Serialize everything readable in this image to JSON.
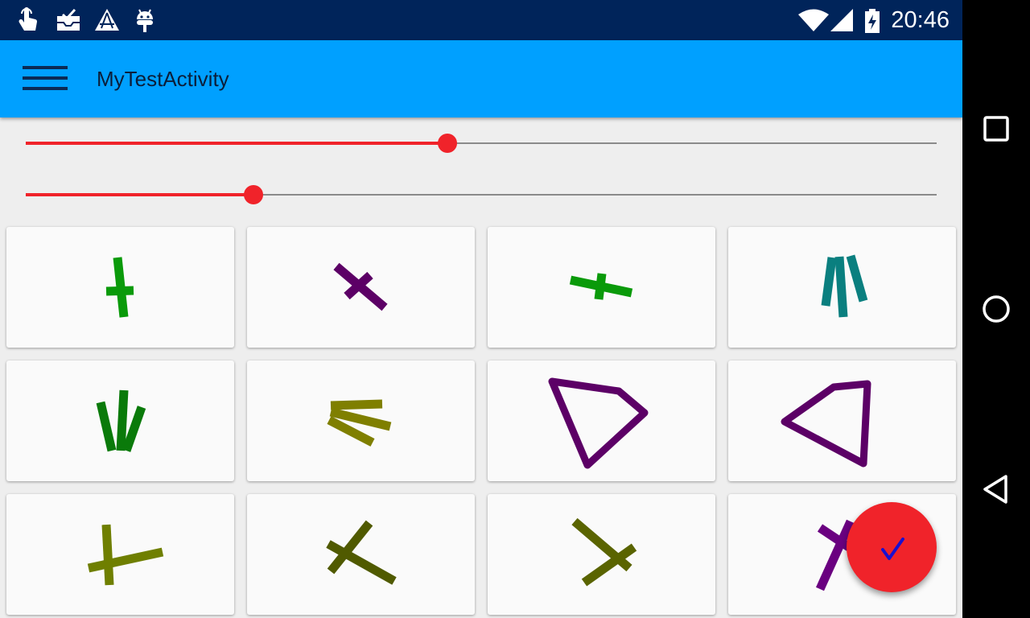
{
  "status_bar": {
    "time": "20:46",
    "notification_icons": [
      "touch-icon",
      "inbox-icon",
      "warning-icon",
      "android-icon"
    ],
    "system_icons": [
      "wifi-icon",
      "signal-icon",
      "battery-charging-icon"
    ]
  },
  "toolbar": {
    "title": "MyTestActivity",
    "menu_icon": "hamburger-menu-icon"
  },
  "sliders": [
    {
      "name": "slider-1",
      "value_fraction": 0.463
    },
    {
      "name": "slider-2",
      "value_fraction": 0.25
    }
  ],
  "grid": {
    "columns": 4,
    "rows": 3,
    "cells": [
      {
        "shape": "cross",
        "color": "#0a9a0a"
      },
      {
        "shape": "cross",
        "color": "#5c0066"
      },
      {
        "shape": "cross",
        "color": "#0a9a0a"
      },
      {
        "shape": "fan",
        "color": "#0a7f7f"
      },
      {
        "shape": "fan",
        "color": "#0a7a0a"
      },
      {
        "shape": "fan",
        "color": "#7f7f00"
      },
      {
        "shape": "quadrilateral",
        "color": "#5c0066"
      },
      {
        "shape": "quadrilateral",
        "color": "#5c0066"
      },
      {
        "shape": "cross",
        "color": "#6f7f00"
      },
      {
        "shape": "cross",
        "color": "#505a00"
      },
      {
        "shape": "cross",
        "color": "#5a6400"
      },
      {
        "shape": "cross",
        "color": "#6a0080"
      }
    ]
  },
  "fab": {
    "icon": "check-icon",
    "color": "#f0232a",
    "icon_color": "#1a10d0"
  },
  "nav_bar": {
    "buttons": [
      "recents-button",
      "home-button",
      "back-button"
    ]
  },
  "colors": {
    "status_bar": "#00245a",
    "toolbar": "#00a0ff",
    "accent": "#f0232a",
    "background": "#eeeeee"
  }
}
